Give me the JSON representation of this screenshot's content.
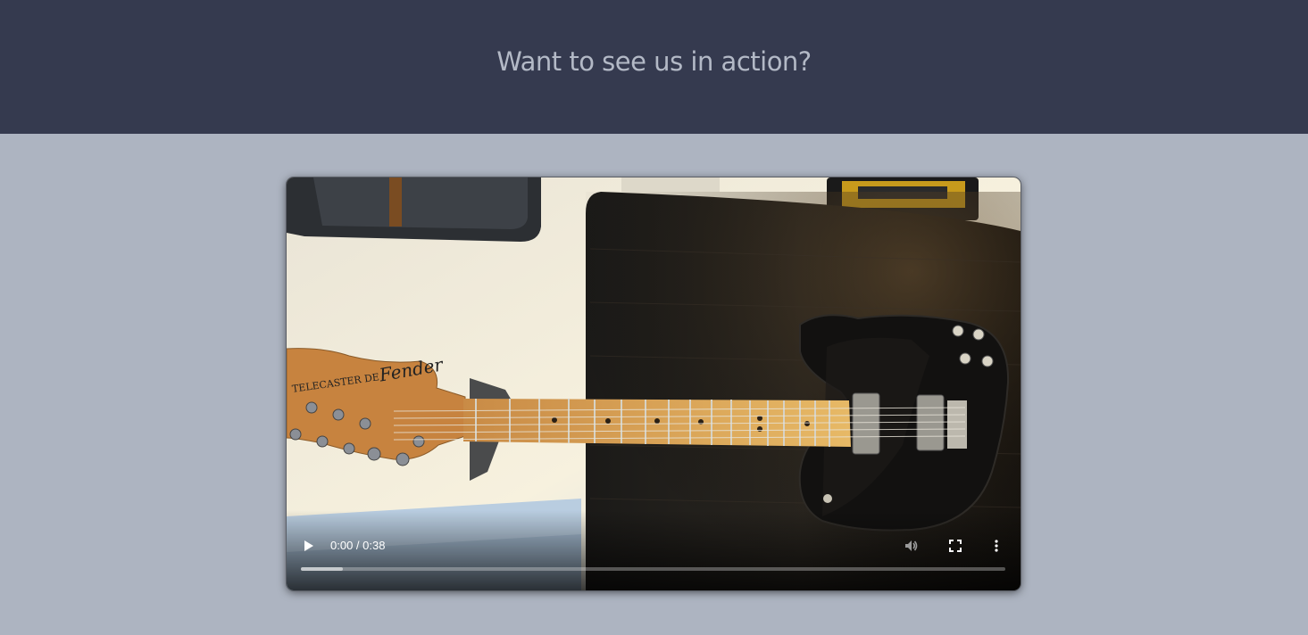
{
  "header": {
    "title": "Want to see us in action?"
  },
  "video": {
    "current_time": "0:00",
    "duration": "0:38",
    "time_display": "0:00 / 0:38",
    "buffered_fraction": 0.06,
    "brand_logo_text": "Fender",
    "headstock_text": "TELECASTER DE"
  },
  "colors": {
    "header_bg": "#353a4f",
    "page_bg": "#adb4c1",
    "header_text": "#b3b9c6"
  },
  "icons": {
    "play": "play-icon",
    "volume": "volume-icon",
    "fullscreen": "fullscreen-icon",
    "more": "more-options-icon"
  }
}
